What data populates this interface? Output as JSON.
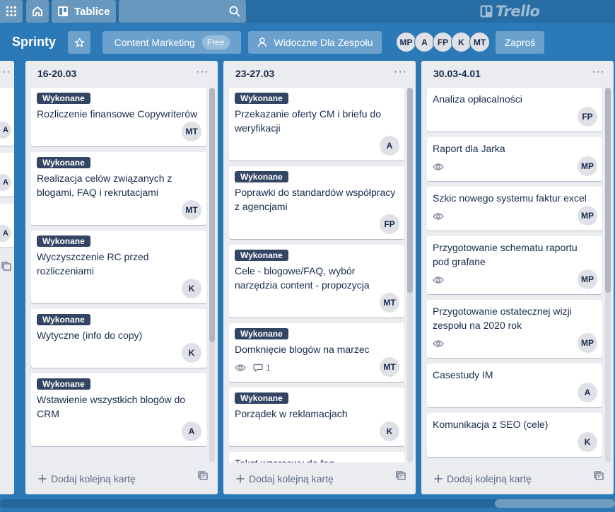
{
  "topbar": {
    "apps_icon": "grid-icon",
    "home_icon": "home-icon",
    "boards_label": "Tablice",
    "search_icon": "search-icon",
    "logo_text": "Trello"
  },
  "board": {
    "title": "Sprinty",
    "star_icon": "star-icon",
    "team_name": "Content Marketing",
    "team_plan": "Free",
    "visibility": "Widoczne Dla Zespołu",
    "members": [
      "MP",
      "A",
      "FP",
      "K",
      "MT"
    ],
    "invite_label": "Zaproś"
  },
  "ghost_list": {
    "avatars": [
      "A",
      "A",
      "A"
    ]
  },
  "lists": [
    {
      "name": "16-20.03",
      "menu": "···",
      "add_card": "Dodaj kolejną kartę",
      "cards": [
        {
          "label": "Wykonane",
          "title": "Rozliczenie finansowe Copywriterów",
          "watch": false,
          "comments": "",
          "member": "MT"
        },
        {
          "label": "Wykonane",
          "title": "Realizacja celów związanych z blogami, FAQ i rekrutacjami",
          "watch": false,
          "comments": "",
          "member": "MT"
        },
        {
          "label": "Wykonane",
          "title": "Wyczyszczenie RC przed rozliczeniami",
          "watch": false,
          "comments": "",
          "member": "K"
        },
        {
          "label": "Wykonane",
          "title": "Wytyczne (info do copy)",
          "watch": false,
          "comments": "",
          "member": "K"
        },
        {
          "label": "Wykonane",
          "title": "Wstawienie wszystkich blogów do CRM",
          "watch": false,
          "comments": "",
          "member": "A"
        }
      ]
    },
    {
      "name": "23-27.03",
      "menu": "···",
      "add_card": "Dodaj kolejną kartę",
      "cards": [
        {
          "label": "Wykonane",
          "title": "Przekazanie oferty CM i briefu do weryfikacji",
          "watch": false,
          "comments": "",
          "member": "A"
        },
        {
          "label": "Wykonane",
          "title": "Poprawki do standardów współpracy z agencjami",
          "watch": false,
          "comments": "",
          "member": "FP"
        },
        {
          "label": "Wykonane",
          "title": "Cele - blogowe/FAQ, wybór narzędzia content - propozycja",
          "watch": false,
          "comments": "",
          "member": "MT"
        },
        {
          "label": "Wykonane",
          "title": "Domknięcie blogów na marzec",
          "watch": true,
          "comments": "1",
          "member": "MT"
        },
        {
          "label": "Wykonane",
          "title": "Porządek w reklamacjach",
          "watch": false,
          "comments": "",
          "member": "K"
        },
        {
          "label": "",
          "title": "Tekst wzorcowy do faq",
          "watch": false,
          "comments": "",
          "member": ""
        }
      ]
    },
    {
      "name": "30.03-4.01",
      "menu": "···",
      "add_card": "Dodaj kolejną kartę",
      "cards": [
        {
          "label": "",
          "title": "Analiza opłacalności",
          "watch": false,
          "comments": "",
          "member": "FP"
        },
        {
          "label": "",
          "title": "Raport dla Jarka",
          "watch": true,
          "comments": "",
          "member": "MP"
        },
        {
          "label": "",
          "title": "Szkic nowego systemu faktur excel",
          "watch": true,
          "comments": "",
          "member": "MP"
        },
        {
          "label": "",
          "title": "Przygotowanie schematu raportu pod grafane",
          "watch": true,
          "comments": "",
          "member": "MP"
        },
        {
          "label": "",
          "title": "Przygotowanie ostatecznej wizji zespołu na 2020 rok",
          "watch": true,
          "comments": "",
          "member": "MP"
        },
        {
          "label": "",
          "title": "Casestudy IM",
          "watch": false,
          "comments": "",
          "member": "A"
        },
        {
          "label": "",
          "title": "Komunikacja z SEO (cele)",
          "watch": false,
          "comments": "",
          "member": "K"
        }
      ]
    }
  ],
  "icons": {
    "watch": "eye-icon",
    "comment": "comment-icon",
    "add": "plus-icon",
    "template": "card-template-icon"
  },
  "colors": {
    "board_bg": "#2b79b6",
    "label_bg": "#344563",
    "list_bg": "#ebecf0"
  }
}
